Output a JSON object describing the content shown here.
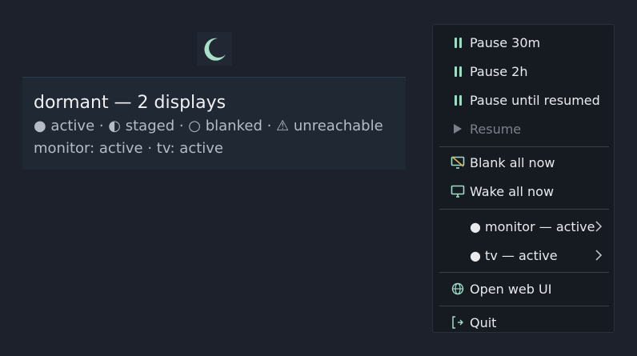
{
  "tray": {
    "icon": "moon-icon",
    "accent": "#a9e0c8"
  },
  "tooltip": {
    "title": "dormant — 2 displays",
    "legend": "● active · ◐ staged · ○ blanked · ⚠ unreachable",
    "status": "monitor: active · tv: active"
  },
  "menu": {
    "pause_30m": "Pause 30m",
    "pause_2h": "Pause 2h",
    "pause_until": "Pause until resumed",
    "resume": "Resume",
    "blank_all": "Blank all now",
    "wake_all": "Wake all now",
    "monitor": "● monitor — active",
    "tv": "● tv — active",
    "open_web": "Open web UI",
    "quit": "Quit"
  },
  "colors": {
    "icon": "#9fdcc6",
    "disabled": "#7b818b",
    "background": "#1c212b",
    "menu_bg": "#161b22"
  }
}
